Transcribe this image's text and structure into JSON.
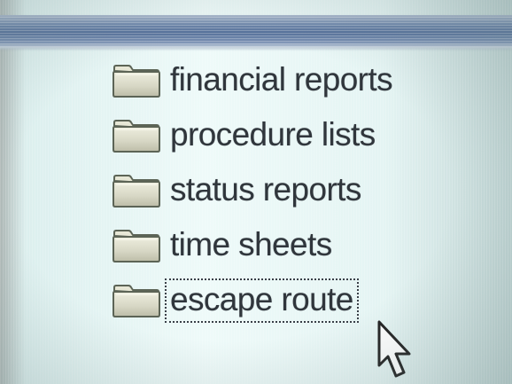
{
  "folders": [
    {
      "label": "financial reports",
      "icon": "folder-icon",
      "focused": false
    },
    {
      "label": "procedure lists",
      "icon": "folder-icon",
      "focused": false
    },
    {
      "label": "status reports",
      "icon": "folder-icon",
      "focused": false
    },
    {
      "label": "time sheets",
      "icon": "folder-icon",
      "focused": false
    },
    {
      "label": "escape route",
      "icon": "folder-icon",
      "focused": true
    }
  ],
  "cursor": {
    "icon": "mouse-pointer-icon"
  },
  "colors": {
    "title_bar": "#5a74a0",
    "background": "#e6f6f5",
    "label_text": "#30363c",
    "folder_fill": "#d8d8c6",
    "folder_outline": "#5c6456"
  }
}
